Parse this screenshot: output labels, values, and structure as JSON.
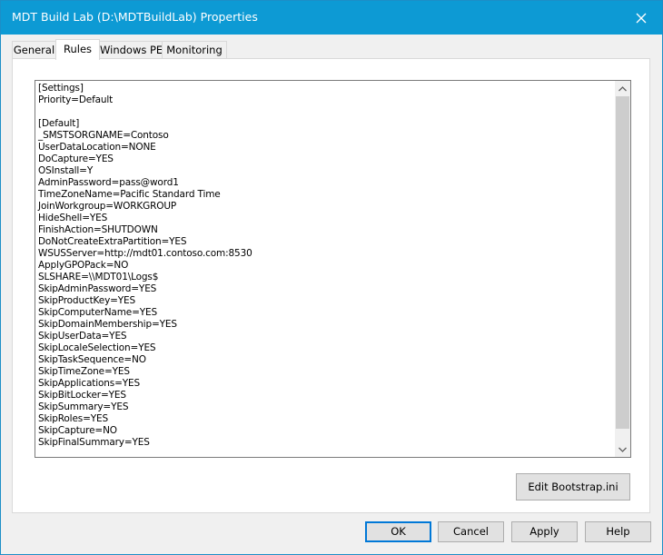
{
  "window": {
    "title": "MDT Build Lab (D:\\MDTBuildLab) Properties",
    "close_icon": "close-x-icon"
  },
  "tabs": [
    {
      "label": "General",
      "active": false
    },
    {
      "label": "Rules",
      "active": true
    },
    {
      "label": "Windows PE",
      "active": false
    },
    {
      "label": "Monitoring",
      "active": false
    }
  ],
  "rules": {
    "text": "[Settings]\nPriority=Default\n\n[Default]\n_SMSTSORGNAME=Contoso\nUserDataLocation=NONE\nDoCapture=YES\nOSInstall=Y\nAdminPassword=pass@word1\nTimeZoneName=Pacific Standard Time\nJoinWorkgroup=WORKGROUP\nHideShell=YES\nFinishAction=SHUTDOWN\nDoNotCreateExtraPartition=YES\nWSUSServer=http://mdt01.contoso.com:8530\nApplyGPOPack=NO\nSLSHARE=\\\\MDT01\\Logs$\nSkipAdminPassword=YES\nSkipProductKey=YES\nSkipComputerName=YES\nSkipDomainMembership=YES\nSkipUserData=YES\nSkipLocaleSelection=YES\nSkipTaskSequence=NO\nSkipTimeZone=YES\nSkipApplications=YES\nSkipBitLocker=YES\nSkipSummary=YES\nSkipRoles=YES\nSkipCapture=NO\nSkipFinalSummary=YES"
  },
  "buttons": {
    "edit_bootstrap": "Edit Bootstrap.ini",
    "ok": "OK",
    "cancel": "Cancel",
    "apply": "Apply",
    "help": "Help"
  },
  "colors": {
    "titlebar": "#0d9ad4",
    "focus_border": "#0078d7"
  }
}
